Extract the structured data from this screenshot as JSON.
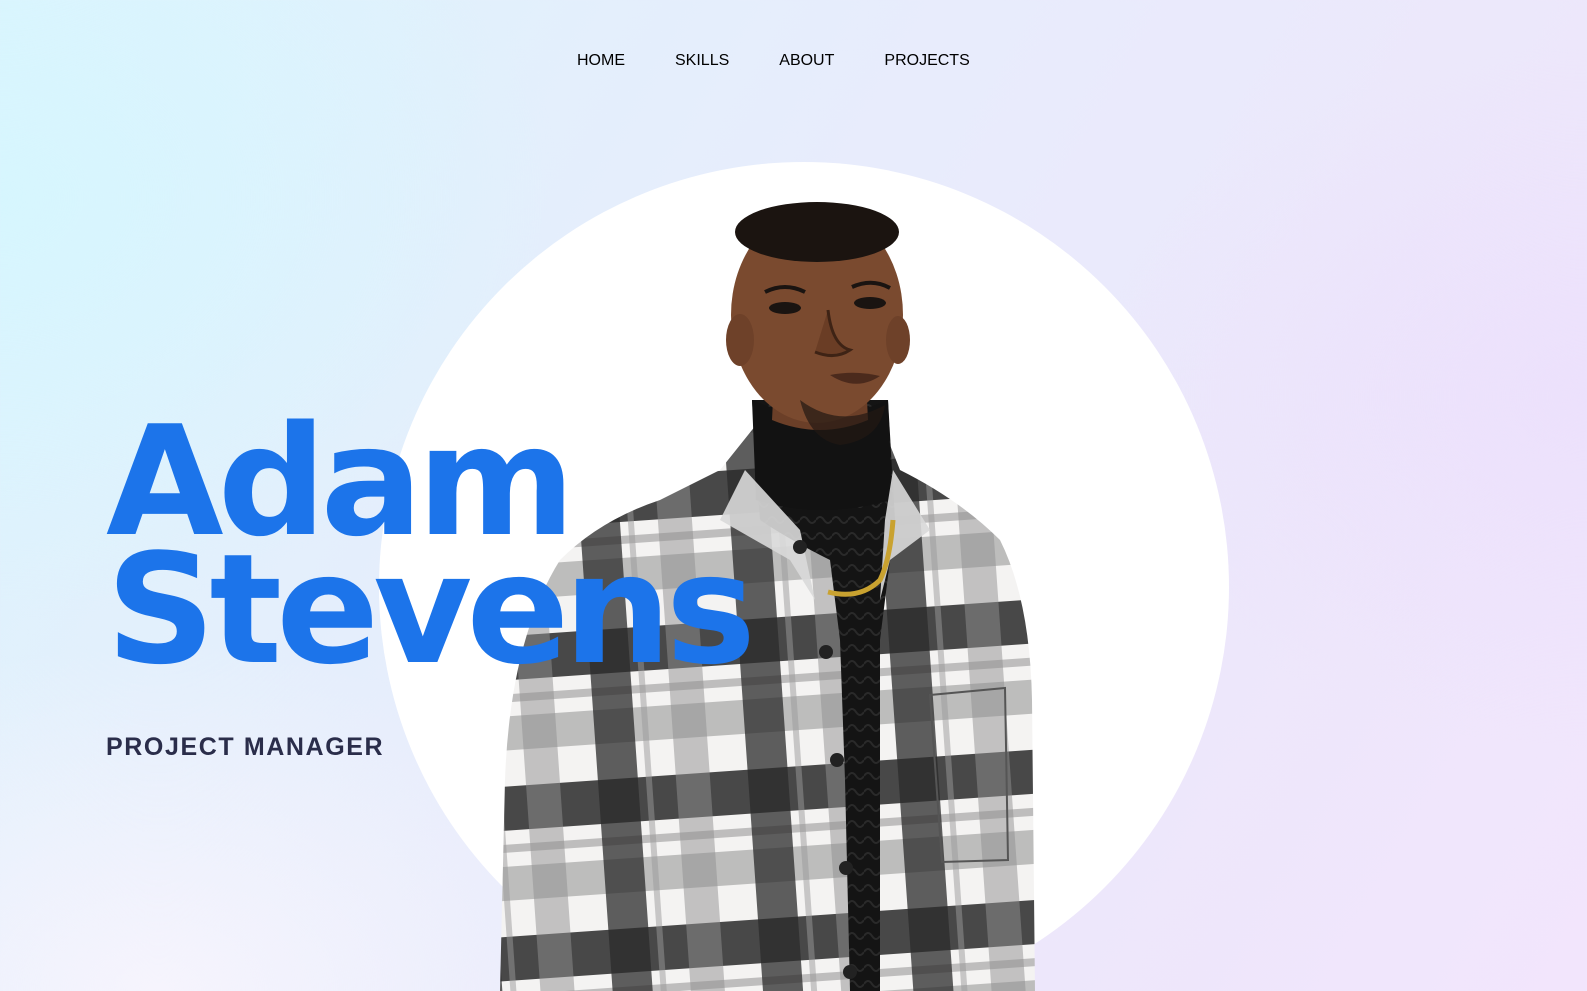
{
  "nav": {
    "items": [
      {
        "label": "HOME",
        "active": true
      },
      {
        "label": "SKILLS",
        "active": false
      },
      {
        "label": "ABOUT",
        "active": false
      },
      {
        "label": "PROJECTS",
        "active": false
      }
    ],
    "active_color": "#1e74e8",
    "text_color": "#2b2b44"
  },
  "hero": {
    "first_name": "Adam",
    "last_name": "Stevens",
    "role": "PROJECT MANAGER",
    "name_color": "#1c74ea",
    "photo_icon": "portrait-photo"
  }
}
